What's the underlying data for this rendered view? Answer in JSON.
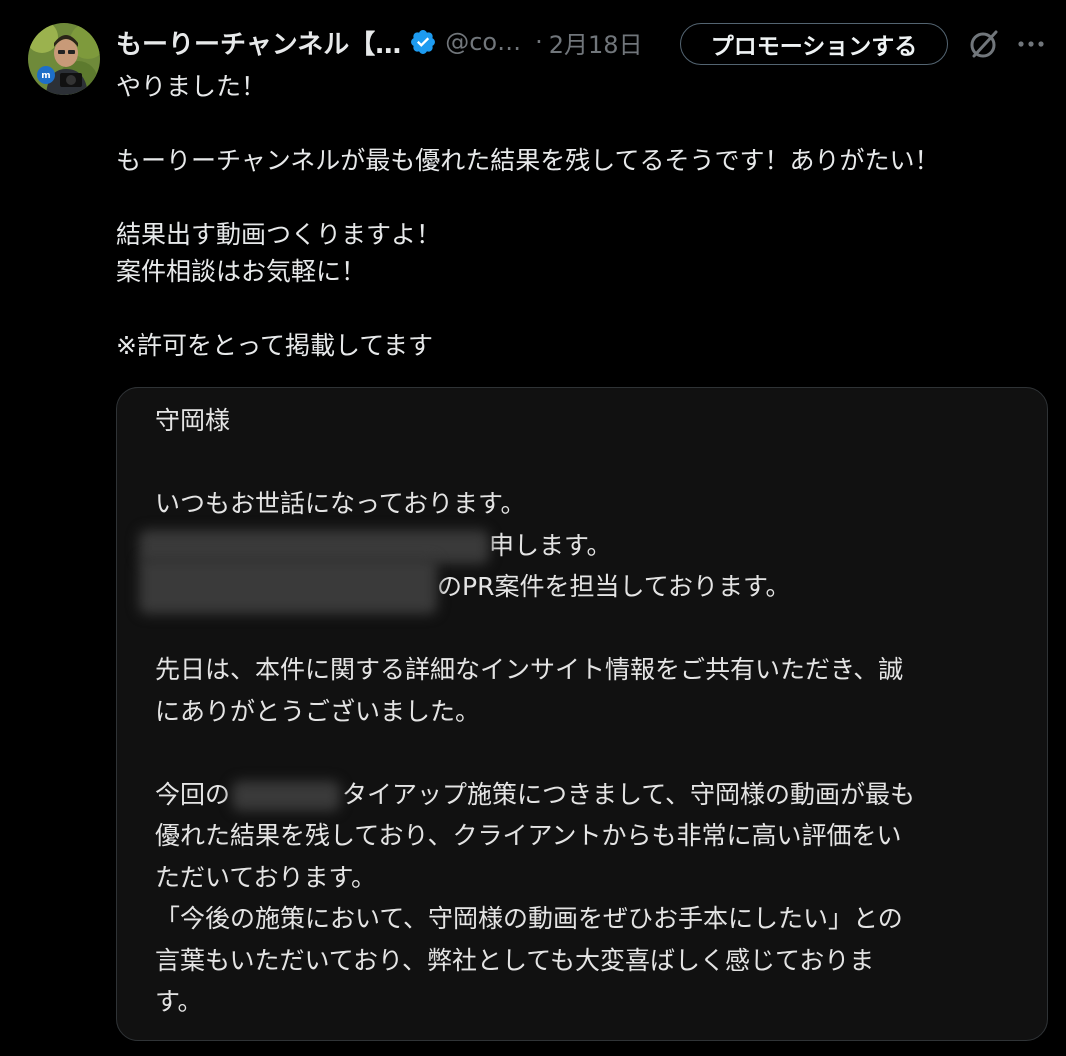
{
  "post": {
    "author": {
      "display_name": "もーりーチャンネル【…",
      "handle": "@co…",
      "verified": true
    },
    "separator": "·",
    "date": "2月18日",
    "promote_label": "プロモーションする",
    "text_lines": [
      "やりました！",
      "",
      "もーりーチャンネルが最も優れた結果を残してるそうです！ありがたい！",
      "",
      "結果出す動画つくりますよ！",
      "案件相談はお気軽に！",
      "",
      "※許可をとって掲載してます"
    ]
  },
  "media": {
    "email": {
      "salutation": "守岡様",
      "line_greeting": "いつもお世話になっております。",
      "line_name_suffix": "申します。",
      "line_pr_suffix": "のPR案件を担当しております。",
      "para_thanks_1": "先日は、本件に関する詳細なインサイト情報をご共有いただき、誠",
      "para_thanks_2": "にありがとうございました。",
      "para_result_1_prefix": "今回の",
      "para_result_1_suffix": "タイアップ施策につきまして、守岡様の動画が最も",
      "para_result_2": "優れた結果を残しており、クライアントからも非常に高い評価をい",
      "para_result_3": "ただいております。",
      "para_result_4": "「今後の施策において、守岡様の動画をぜひお手本にしたい」との",
      "para_result_5": "言葉もいただいており、弊社としても大変喜ばしく感じておりま",
      "para_result_6": "す。"
    }
  },
  "icons": {
    "verified": "verified-badge-icon",
    "grok": "grok-icon",
    "more": "more-icon"
  },
  "colors": {
    "background": "#000000",
    "primary_text": "#e7e9ea",
    "secondary_text": "#71767b",
    "verified_blue": "#1d9bf0",
    "card_background": "#111111",
    "border": "#2f3336"
  }
}
